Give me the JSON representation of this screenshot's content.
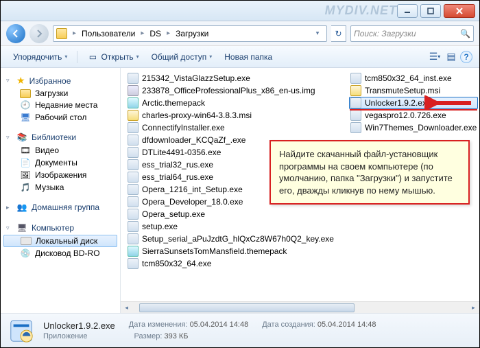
{
  "watermark": "MYDIV.NET",
  "breadcrumb": {
    "root_icon": "computer",
    "parts": [
      "Пользователи",
      "DS",
      "Загрузки"
    ]
  },
  "search": {
    "placeholder": "Поиск: Загрузки"
  },
  "toolbar": {
    "organize": "Упорядочить",
    "open": "Открыть",
    "share": "Общий доступ",
    "new_folder": "Новая папка"
  },
  "sidebar": {
    "favorites": {
      "label": "Избранное",
      "items": [
        "Загрузки",
        "Недавние места",
        "Рабочий стол"
      ]
    },
    "libraries": {
      "label": "Библиотеки",
      "items": [
        "Видео",
        "Документы",
        "Изображения",
        "Музыка"
      ]
    },
    "homegroup": {
      "label": "Домашняя группа"
    },
    "computer": {
      "label": "Компьютер",
      "items": [
        "Локальный диск",
        "Дисковод BD-RO"
      ]
    }
  },
  "files_col1": [
    {
      "n": "215342_VistaGlazzSetup.exe",
      "t": "exe"
    },
    {
      "n": "233878_OfficeProfessionalPlus_x86_en-us.img",
      "t": "img"
    },
    {
      "n": "Arctic.themepack",
      "t": "theme"
    },
    {
      "n": "charles-proxy-win64-3.8.3.msi",
      "t": "msi"
    },
    {
      "n": "ConnectifyInstaller.exe",
      "t": "exe"
    },
    {
      "n": "dfdownloader_KCQaZf_.exe",
      "t": "exe"
    },
    {
      "n": "DTLite4491-0356.exe",
      "t": "exe"
    },
    {
      "n": "ess_trial32_rus.exe",
      "t": "exe"
    },
    {
      "n": "ess_trial64_rus.exe",
      "t": "exe"
    },
    {
      "n": "Opera_1216_int_Setup.exe",
      "t": "exe"
    },
    {
      "n": "Opera_Developer_18.0.exe",
      "t": "exe"
    },
    {
      "n": "Opera_setup.exe",
      "t": "exe"
    },
    {
      "n": "setup.exe",
      "t": "exe"
    },
    {
      "n": "Setup_serial_aPuJzdtG_hlQxCz8W67h0Q2_key.exe",
      "t": "exe"
    },
    {
      "n": "SierraSunsetsTomMansfield.themepack",
      "t": "theme"
    },
    {
      "n": "tcm850x32_64.exe",
      "t": "exe"
    }
  ],
  "files_col2": [
    {
      "n": "tcm850x32_64_inst.exe",
      "t": "exe"
    },
    {
      "n": "TransmuteSetup.msi",
      "t": "msi"
    },
    {
      "n": "Unlocker1.9.2.exe",
      "t": "exe",
      "sel": true
    },
    {
      "n": "vegaspro12.0.726.exe",
      "t": "exe"
    },
    {
      "n": "Win7Themes_Downloader.exe",
      "t": "exe"
    }
  ],
  "annotation": "Найдите скачанный файл-установщик программы на своем компьютере (по умолчанию, папка \"Загрузки\") и запустите его, дважды кликнув по нему мышью.",
  "details": {
    "name": "Unlocker1.9.2.exe",
    "type": "Приложение",
    "modified_lbl": "Дата изменения:",
    "modified": "05.04.2014 14:48",
    "created_lbl": "Дата создания:",
    "created": "05.04.2014 14:48",
    "size_lbl": "Размер:",
    "size": "393 КБ"
  }
}
